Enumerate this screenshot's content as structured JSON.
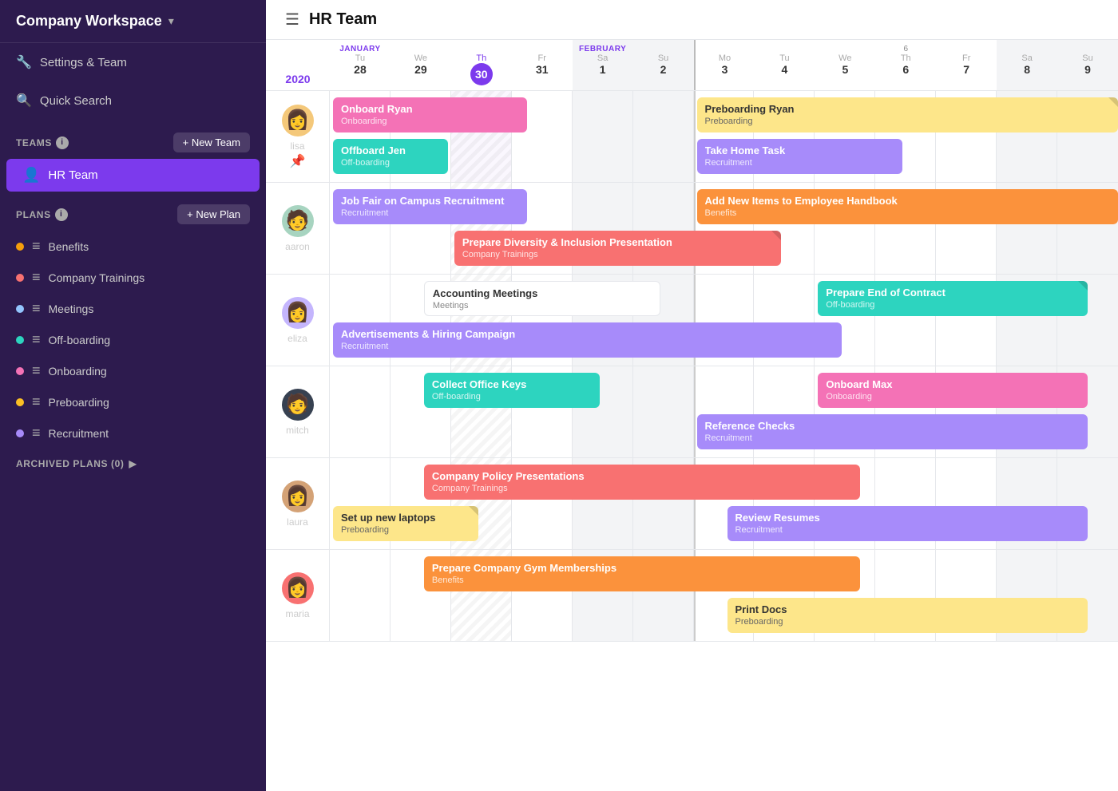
{
  "sidebar": {
    "workspace_title": "Company Workspace",
    "settings_label": "Settings & Team",
    "search_label": "Quick Search",
    "teams_section": "TEAMS",
    "new_team_label": "+ New Team",
    "teams": [
      {
        "id": "hr",
        "label": "HR Team",
        "active": true
      }
    ],
    "plans_section": "PLANS",
    "new_plan_label": "+ New Plan",
    "plans": [
      {
        "label": "Benefits",
        "color": "#f59e0b"
      },
      {
        "label": "Company Trainings",
        "color": "#f87171"
      },
      {
        "label": "Meetings",
        "color": "#93c5fd"
      },
      {
        "label": "Off-boarding",
        "color": "#2dd4bf"
      },
      {
        "label": "Onboarding",
        "color": "#f472b6"
      },
      {
        "label": "Preboarding",
        "color": "#fbbf24"
      },
      {
        "label": "Recruitment",
        "color": "#a78bfa"
      }
    ],
    "archived_label": "ARCHIVED PLANS (0)"
  },
  "main": {
    "title": "HR Team",
    "year": "2020",
    "months": [
      {
        "label": "JANUARY",
        "col_start": 1
      },
      {
        "label": "FEBRUARY",
        "col_start": 5
      }
    ],
    "days": [
      {
        "dow": "Tu",
        "num": "28",
        "today": false,
        "weekend": false,
        "hatch": false
      },
      {
        "dow": "We",
        "num": "29",
        "today": false,
        "weekend": false,
        "hatch": false
      },
      {
        "dow": "Th",
        "num": "30",
        "today": true,
        "weekend": false,
        "hatch": true
      },
      {
        "dow": "Fr",
        "num": "31",
        "today": false,
        "weekend": false,
        "hatch": false
      },
      {
        "dow": "Sa",
        "num": "1",
        "today": false,
        "weekend": true,
        "hatch": false,
        "month": "FEBRUARY"
      },
      {
        "dow": "Su",
        "num": "2",
        "today": false,
        "weekend": true,
        "hatch": false
      },
      {
        "dow": "Mo",
        "num": "3",
        "today": false,
        "weekend": false,
        "hatch": false
      },
      {
        "dow": "Tu",
        "num": "4",
        "today": false,
        "weekend": false,
        "hatch": false
      },
      {
        "dow": "We",
        "num": "5",
        "today": false,
        "weekend": false,
        "hatch": false
      },
      {
        "dow": "Th",
        "num": "6",
        "today": false,
        "weekend": false,
        "hatch": false
      },
      {
        "dow": "Fr",
        "num": "7",
        "today": false,
        "weekend": false,
        "hatch": false
      },
      {
        "dow": "Sa",
        "num": "8",
        "today": false,
        "weekend": true,
        "hatch": false
      },
      {
        "dow": "Su",
        "num": "9",
        "today": false,
        "weekend": true,
        "hatch": false
      }
    ],
    "people": [
      {
        "name": "lisa",
        "avatar_color": "#f4c87a",
        "avatar_emoji": "👩",
        "pinned": true,
        "tasks": [
          {
            "title": "Onboard Ryan",
            "subtitle": "Onboarding",
            "color": "#f472b6",
            "col_start": 0,
            "col_span": 3.5,
            "row": 0
          },
          {
            "title": "Offboard Jen",
            "subtitle": "Off-boarding",
            "color": "#2dd4bf",
            "col_start": 0,
            "col_span": 2,
            "row": 1
          },
          {
            "title": "Preboarding Ryan",
            "subtitle": "Preboarding",
            "color": "#fde68a",
            "dark_text": true,
            "col_start": 6,
            "col_span": 6,
            "row": 0,
            "fold": true
          },
          {
            "title": "Take Home Task",
            "subtitle": "Recruitment",
            "color": "#a78bfa",
            "col_start": 6,
            "col_span": 3.5,
            "row": 1
          }
        ]
      },
      {
        "name": "aaron",
        "avatar_color": "#a7d4c0",
        "avatar_emoji": "🧑",
        "pinned": false,
        "tasks": [
          {
            "title": "Job Fair on Campus Recruitment",
            "subtitle": "Recruitment",
            "color": "#a78bfa",
            "col_start": 0,
            "col_span": 3.5,
            "row": 0
          },
          {
            "title": "Prepare Diversity & Inclusion Presentation",
            "subtitle": "Company Trainings",
            "color": "#f87171",
            "col_start": 2,
            "col_span": 5.5,
            "row": 1,
            "fold": true
          },
          {
            "title": "Add New Items to Employee Handbook",
            "subtitle": "Benefits",
            "color": "#fb923c",
            "col_start": 6,
            "col_span": 6,
            "row": 0
          }
        ]
      },
      {
        "name": "eliza",
        "avatar_color": "#c4b5fd",
        "avatar_emoji": "👩",
        "pinned": false,
        "tasks": [
          {
            "title": "Accounting Meetings",
            "subtitle": "Meetings",
            "color": "#ffffff",
            "dark_text": true,
            "col_start": 1.5,
            "col_span": 4,
            "row": 0
          },
          {
            "title": "Advertisements & Hiring Campaign",
            "subtitle": "Recruitment",
            "color": "#a78bfa",
            "col_start": 0,
            "col_span": 8.5,
            "row": 1
          },
          {
            "title": "Prepare End of Contract",
            "subtitle": "Off-boarding",
            "color": "#2dd4bf",
            "col_start": 8,
            "col_span": 4,
            "row": 0,
            "fold": true
          }
        ]
      },
      {
        "name": "mitch",
        "avatar_color": "#374151",
        "avatar_emoji": "🧑",
        "pinned": false,
        "tasks": [
          {
            "title": "Collect Office Keys",
            "subtitle": "Off-boarding",
            "color": "#2dd4bf",
            "col_start": 1.5,
            "col_span": 3,
            "row": 0
          },
          {
            "title": "Onboard Max",
            "subtitle": "Onboarding",
            "color": "#f472b6",
            "col_start": 8,
            "col_span": 4,
            "row": 0
          },
          {
            "title": "Reference Checks",
            "subtitle": "Recruitment",
            "color": "#a78bfa",
            "col_start": 6,
            "col_span": 6,
            "row": 1
          }
        ]
      },
      {
        "name": "laura",
        "avatar_color": "#d4a276",
        "avatar_emoji": "👩",
        "pinned": false,
        "tasks": [
          {
            "title": "Company Policy Presentations",
            "subtitle": "Company Trainings",
            "color": "#f87171",
            "col_start": 1.5,
            "col_span": 7.5,
            "row": 0
          },
          {
            "title": "Set up new laptops",
            "subtitle": "Preboarding",
            "color": "#fde68a",
            "dark_text": true,
            "col_start": 0,
            "col_span": 2.5,
            "row": 1,
            "fold": true
          },
          {
            "title": "Review Resumes",
            "subtitle": "Recruitment",
            "color": "#a78bfa",
            "col_start": 6.5,
            "col_span": 5.5,
            "row": 1
          }
        ]
      },
      {
        "name": "maria",
        "avatar_color": "#f87171",
        "avatar_emoji": "👩",
        "pinned": false,
        "tasks": [
          {
            "title": "Prepare Company Gym Memberships",
            "subtitle": "Benefits",
            "color": "#fb923c",
            "col_start": 1.5,
            "col_span": 7.5,
            "row": 0
          },
          {
            "title": "Print Docs",
            "subtitle": "Preboarding",
            "color": "#fde68a",
            "dark_text": true,
            "col_start": 6.5,
            "col_span": 5.5,
            "row": 1
          }
        ]
      }
    ]
  },
  "colors": {
    "sidebar_bg": "#2d1b4e",
    "active_team": "#7c3aed",
    "accent": "#7c3aed"
  }
}
